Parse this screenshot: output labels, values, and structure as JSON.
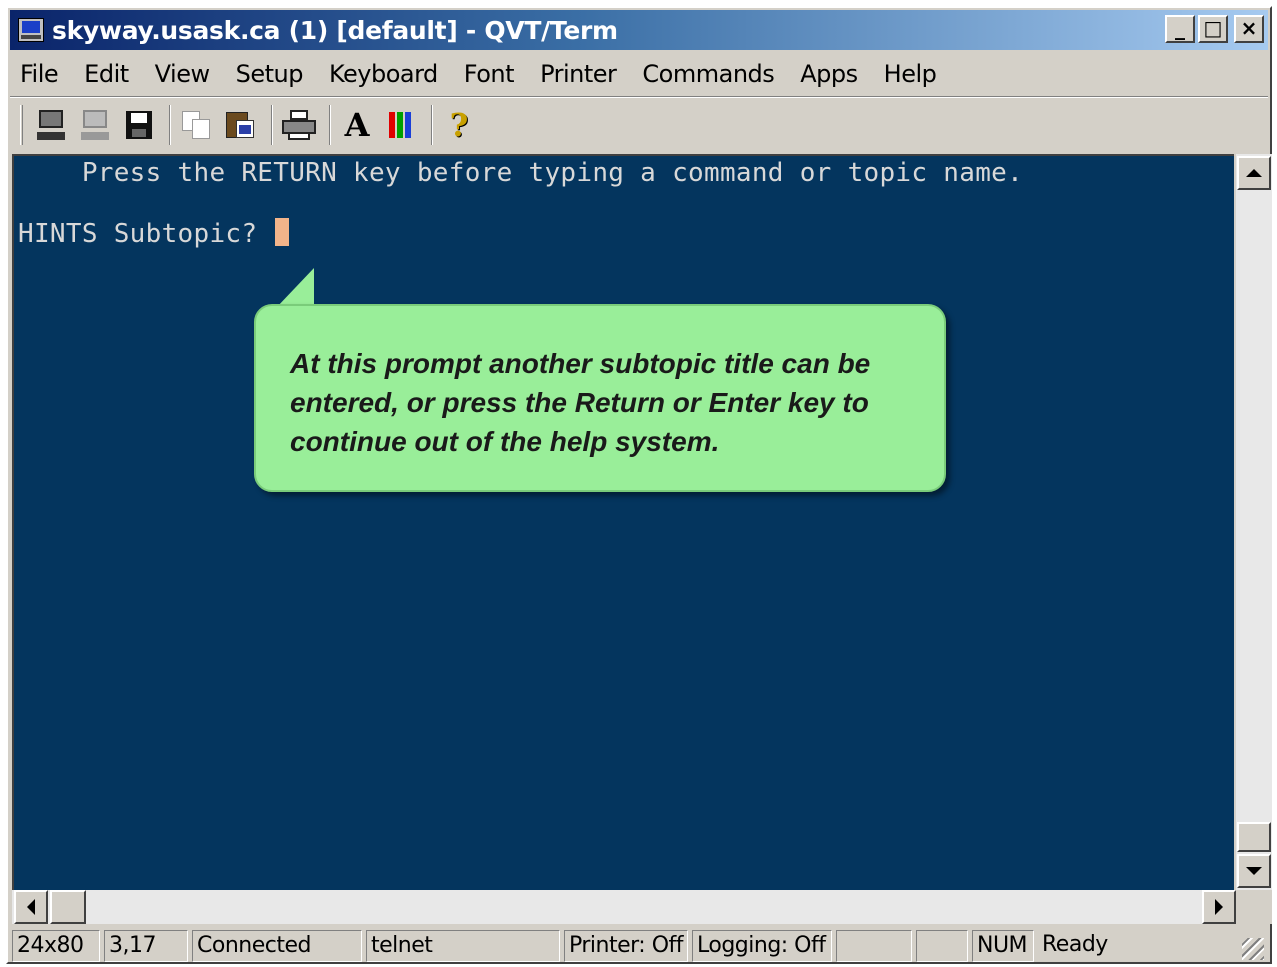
{
  "window": {
    "title": "skyway.usask.ca (1) [default] - QVT/Term",
    "buttons": {
      "minimize": "_",
      "maximize": "□",
      "close": "×"
    }
  },
  "menubar": {
    "items": [
      "File",
      "Edit",
      "View",
      "Setup",
      "Keyboard",
      "Font",
      "Printer",
      "Commands",
      "Apps",
      "Help"
    ]
  },
  "toolbar": {
    "icons": [
      "connect-terminal-icon",
      "disconnect-terminal-icon",
      "save-icon",
      "copy-icon",
      "paste-icon",
      "print-icon",
      "font-icon",
      "colors-icon",
      "help-icon"
    ],
    "font_glyph": "A",
    "help_glyph": "?",
    "color_bars": [
      "#e00000",
      "#00a000",
      "#1a3fd8"
    ]
  },
  "terminal": {
    "line1": "    Press the RETURN key before typing a command or topic name.",
    "line2": "HINTS Subtopic? ",
    "background": "#04355e",
    "cursor_color": "#f2b48a"
  },
  "callout": {
    "text": "At this prompt another subtopic title can be entered, or press the Return or Enter key to continue out of the help system.",
    "color": "#99ee99"
  },
  "statusbar": {
    "size": "24x80",
    "position": "3,17",
    "connection": "Connected",
    "protocol": "telnet",
    "printer": "Printer: Off",
    "logging": "Logging: Off",
    "empty1": "",
    "empty2": "",
    "num": "NUM",
    "state": "Ready"
  }
}
